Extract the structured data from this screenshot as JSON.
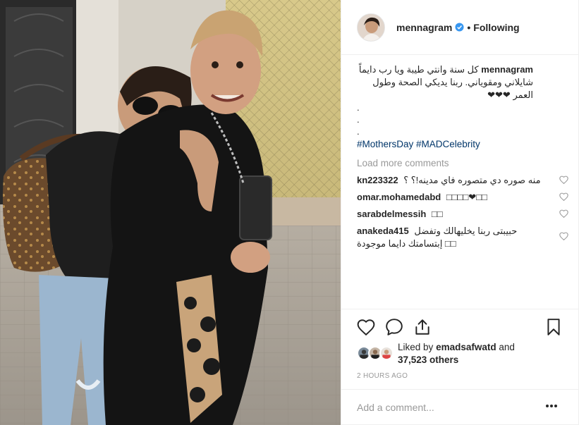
{
  "post": {
    "username": "mennagram",
    "follow_status": "Following",
    "separator": "•",
    "caption_username": "mennagram",
    "caption_text": "كل سنة وانتي طيبة ويا رب دايماً شايلاني ومقوياني. ربنا يديكي الصحة وطول العمر",
    "caption_hearts": "❤❤❤",
    "caption_dots": [
      ".",
      ".",
      "."
    ],
    "hashtags": "#MothersDay #MADCelebrity",
    "load_more": "Load more comments",
    "comments": [
      {
        "user": "kn223322",
        "text": "منه صوره دي متصوره فاي مدينه!؟ ؟"
      },
      {
        "user": "omar.mohamedabd",
        "text": "□□□□❤□□"
      },
      {
        "user": "sarabdelmessih",
        "text": "□□"
      },
      {
        "user": "anakeda415",
        "text": "حبيبتى ربنا يخليهالك وتفضل إبتسامتك دايما موجودة □□"
      }
    ],
    "liked_by_prefix": "Liked by",
    "liked_by_user": "emadsafwatd",
    "liked_by_and": "and",
    "others_count": "37,523 others",
    "time_ago": "2 HOURS AGO",
    "add_comment_placeholder": "Add a comment...",
    "icons": {
      "like": "heart-outline-icon",
      "comment": "comment-bubble-icon",
      "share": "share-icon",
      "save": "bookmark-icon",
      "more": "more-options-icon",
      "verified": "verified-badge-icon"
    },
    "colors": {
      "hashtag": "#003569",
      "muted": "#999999",
      "verified": "#3897f0",
      "text": "#262626"
    }
  }
}
